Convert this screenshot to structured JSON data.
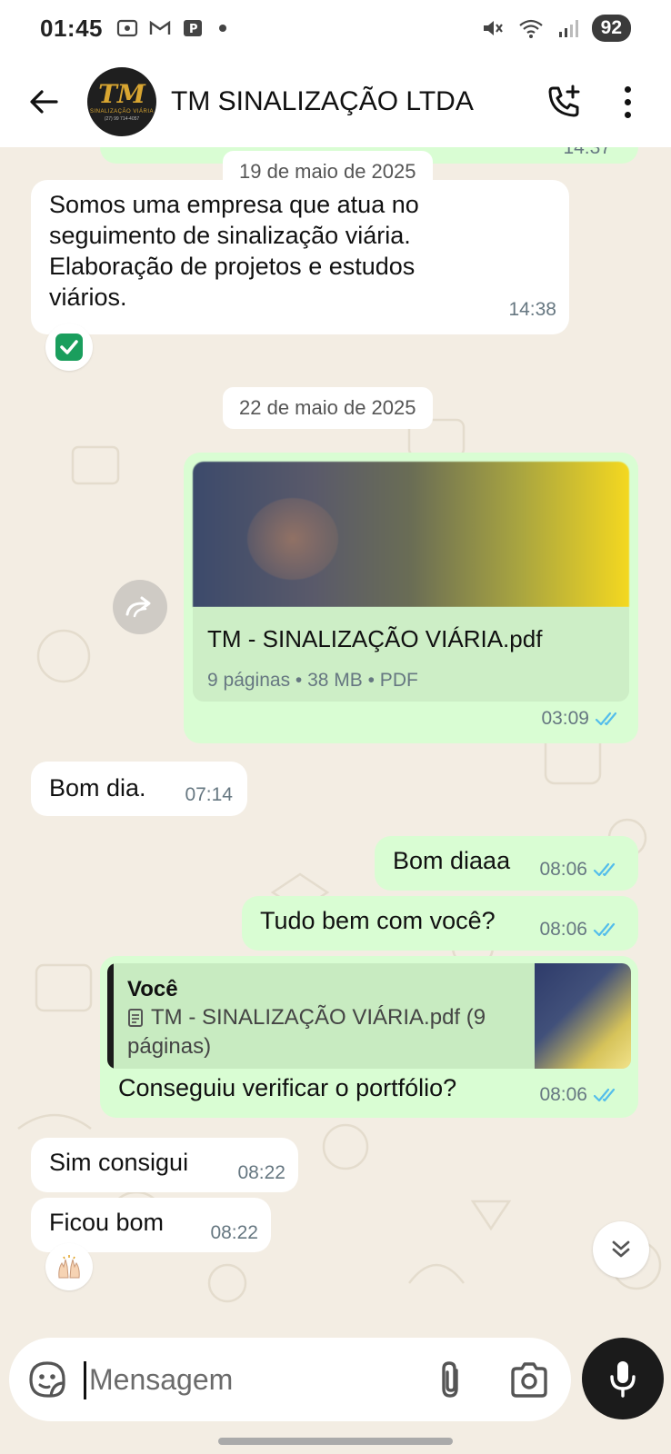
{
  "status_bar": {
    "time": "01:45",
    "battery": "92"
  },
  "header": {
    "title": "TM SINALIZAÇÃO LTDA",
    "avatar_logo": "TM",
    "avatar_sub": "SINALIZAÇÃO VIÁRIA",
    "avatar_phone": "(27) 99 714-4057"
  },
  "chat": {
    "dates": [
      "19 de maio de 2025",
      "22 de maio de 2025"
    ],
    "partial_prev_time": "14:37",
    "messages": [
      {
        "dir": "in",
        "lines": [
          "Somos uma empresa que atua no",
          "seguimento de sinalização viária.",
          "Elaboração de projetos e estudos",
          "viários."
        ],
        "time": "14:38",
        "reaction": "check-mark"
      },
      {
        "dir": "out",
        "type": "document",
        "file_name": "TM - SINALIZAÇÃO VIÁRIA.pdf",
        "file_meta": "9 páginas • 38 MB • PDF",
        "time": "03:09",
        "read": true
      },
      {
        "dir": "in",
        "text": "Bom dia.",
        "time": "07:14"
      },
      {
        "dir": "out",
        "text": "Bom diaaa",
        "time": "08:06",
        "read": true
      },
      {
        "dir": "out",
        "text": "Tudo bem com você?",
        "time": "08:06",
        "read": true
      },
      {
        "dir": "out",
        "type": "reply",
        "quote_author": "Você",
        "quote_lines": [
          "TM - SINALIZAÇÃO VIÁRIA.pdf (9",
          "páginas)"
        ],
        "text": "Conseguiu verificar o portfólio?",
        "time": "08:06",
        "read": true
      },
      {
        "dir": "in",
        "text": "Sim consigui",
        "time": "08:22"
      },
      {
        "dir": "in",
        "text": "Ficou bom",
        "time": "08:22",
        "reaction": "raised-hands"
      }
    ]
  },
  "input": {
    "placeholder": "Mensagem"
  },
  "colors": {
    "outgoing_bubble": "#d9fdd3",
    "incoming_bubble": "#ffffff",
    "chat_background": "#f3ede3",
    "read_ticks": "#53bdeb"
  }
}
